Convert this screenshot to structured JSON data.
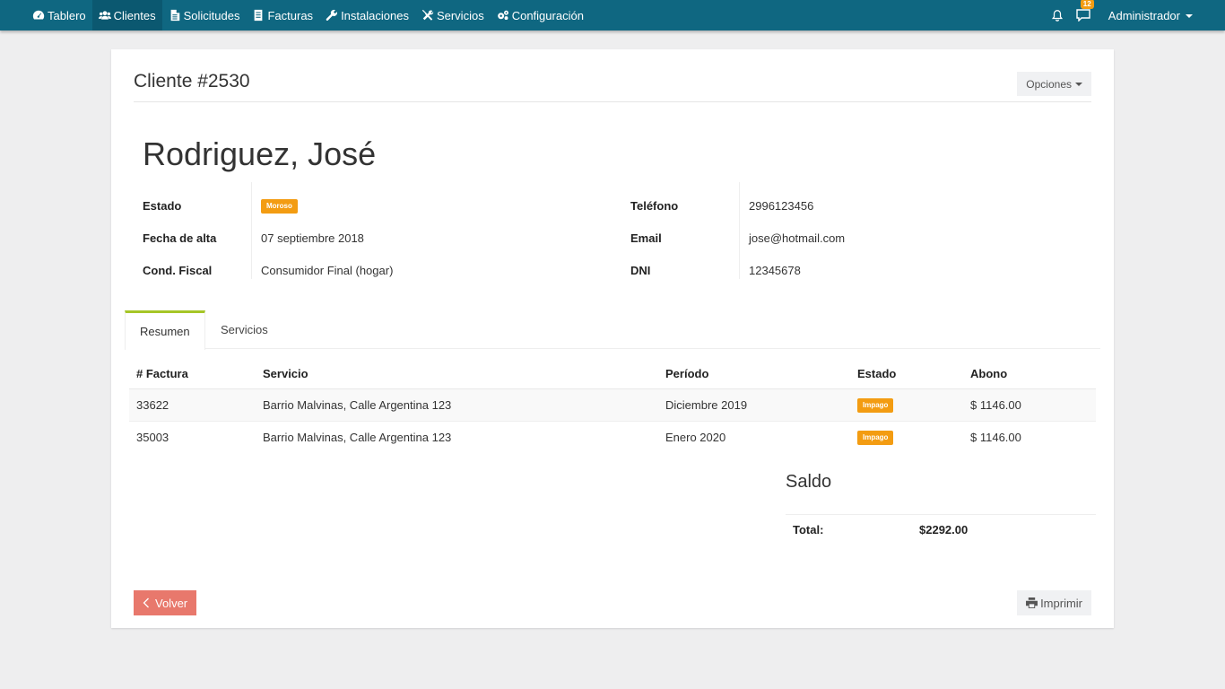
{
  "nav": {
    "items": [
      {
        "label": "Tablero",
        "icon": "dashboard-icon"
      },
      {
        "label": "Clientes",
        "icon": "users-icon"
      },
      {
        "label": "Solicitudes",
        "icon": "file-icon"
      },
      {
        "label": "Facturas",
        "icon": "invoice-icon"
      },
      {
        "label": "Instalaciones",
        "icon": "wrench-icon"
      },
      {
        "label": "Servicios",
        "icon": "tools-icon"
      },
      {
        "label": "Configuración",
        "icon": "gears-icon"
      }
    ],
    "active": "Clientes",
    "messages_count": "12",
    "user": "Administrador"
  },
  "page": {
    "title": "Cliente #2530",
    "options_label": "Opciones",
    "client_name": "Rodriguez, José"
  },
  "info": {
    "left": [
      {
        "label": "Estado",
        "value": "Moroso",
        "badge": true
      },
      {
        "label": "Fecha de alta",
        "value": "07 septiembre 2018"
      },
      {
        "label": "Cond. Fiscal",
        "value": "Consumidor Final (hogar)"
      }
    ],
    "right": [
      {
        "label": "Teléfono",
        "value": "2996123456"
      },
      {
        "label": "Email",
        "value": "jose@hotmail.com"
      },
      {
        "label": "DNI",
        "value": "12345678"
      }
    ]
  },
  "tabs": [
    {
      "label": "Resumen",
      "active": true
    },
    {
      "label": "Servicios",
      "active": false
    }
  ],
  "table": {
    "headers": [
      "# Factura",
      "Servicio",
      "Período",
      "Estado",
      "Abono"
    ],
    "rows": [
      {
        "factura": "33622",
        "servicio": "Barrio Malvinas, Calle Argentina 123",
        "periodo": "Diciembre 2019",
        "estado": "Impago",
        "abono": "$ 1146.00"
      },
      {
        "factura": "35003",
        "servicio": "Barrio Malvinas, Calle Argentina 123",
        "periodo": "Enero 2020",
        "estado": "Impago",
        "abono": "$ 1146.00"
      }
    ]
  },
  "saldo": {
    "title": "Saldo",
    "total_label": "Total:",
    "total_value": "$2292.00"
  },
  "buttons": {
    "back": "Volver",
    "print": "Imprimir"
  },
  "colors": {
    "navbar": "#0f6781",
    "badge": "#f39c12",
    "tab_active": "#a6c627",
    "back_button": "#e8786c"
  }
}
